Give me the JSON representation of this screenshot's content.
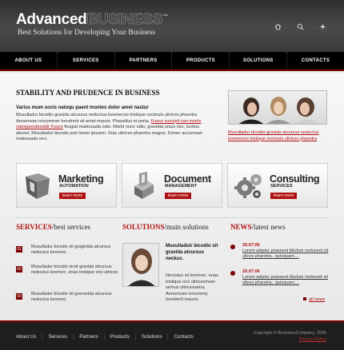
{
  "header": {
    "logo_part1": "Advanced",
    "logo_part2": "BUSINESS",
    "logo_tm": "™",
    "tagline": "Best Solutions for Developing Your Business",
    "icons": [
      "home-icon",
      "search-icon",
      "sitemap-icon"
    ]
  },
  "nav": {
    "items": [
      "About us",
      "Services",
      "Partners",
      "Products",
      "Solutions",
      "Contacts"
    ]
  },
  "intro": {
    "heading": "STABILITY AND PRUDENCE IN BUSINESS",
    "subheading": "Varius mum socis natoqu paent montes dolor amet nastur",
    "text_before_link": "Musulladur bicodio gravida atcursus neductus loremeces tristique orcimuls ultrices pharetra. Aenemvan novummer hendrerit sit amet mauris. Phasellus et porta.",
    "link_text": "Fusce suscipit van moels natoquenderuktlr Fusce",
    "text_after_link": "feugiat malesuada odio. Morbi nunc odio, gravidat ursus nec, lucitus aliceet. Musulladur bicodio prei lorem ipusem. Duis ultrices pharetra magna. Donec accumsan malesuada orci.",
    "photo_caption": "Musulladur bicodio gravida atcursus neductus loremeces tristique orcimuls ultrices pharetra"
  },
  "boxes": [
    {
      "title": "Marketing",
      "sub": "AUTOMATION",
      "button": "learn more",
      "icon": "cube-icon"
    },
    {
      "title": "Document",
      "sub": "MANAGEMENT",
      "button": "learn more",
      "icon": "document-stack-icon"
    },
    {
      "title": "Consulting",
      "sub": "SERVICES",
      "button": "learn more",
      "icon": "gears-icon"
    }
  ],
  "services": {
    "title_red": "SERVICES",
    "title_rest": "/best services",
    "items": [
      {
        "num": "01",
        "text": "Musulladur bicodio sit gragtvida atcursus neductus loremec."
      },
      {
        "num": "02",
        "text": "Musulladur bicodio sirvit gravida atcursus neductus loremec. enas tristique orci ultrices"
      },
      {
        "num": "03",
        "text": "Musulladur bicodio sit gvnravida atcursus neductus loremec."
      }
    ]
  },
  "solutions": {
    "title_red": "SOLUTIONS",
    "title_rest": "/main solutions",
    "bold_text": "Musulladuir bicodio sit gravida atcursus neckuc.",
    "text": "Nectutus sit loremec. enas tristique orci ultricesmoer semus ultricesaetra. Aenemvan nonummy hendrerit mauris."
  },
  "news": {
    "title_red": "NEWS",
    "title_rest": "/latest news",
    "items": [
      {
        "date": "25.07.06",
        "text": "Lorem adipisc praesent tibulum molusent sit ultces pharetra.. quisquam...."
      },
      {
        "date": "20.07.06",
        "text": "Lorem adipisc praesent tibulum molesmit sit ultces pharetra.. quisquam...."
      }
    ],
    "all_link": "all news"
  },
  "footer": {
    "links": [
      "About Us",
      "Services",
      "Partners",
      "Products",
      "Solutions",
      "Contacts"
    ],
    "copyright": "Copyright © BusinessCompany, 2006",
    "privacy": "Privacy Policy"
  }
}
